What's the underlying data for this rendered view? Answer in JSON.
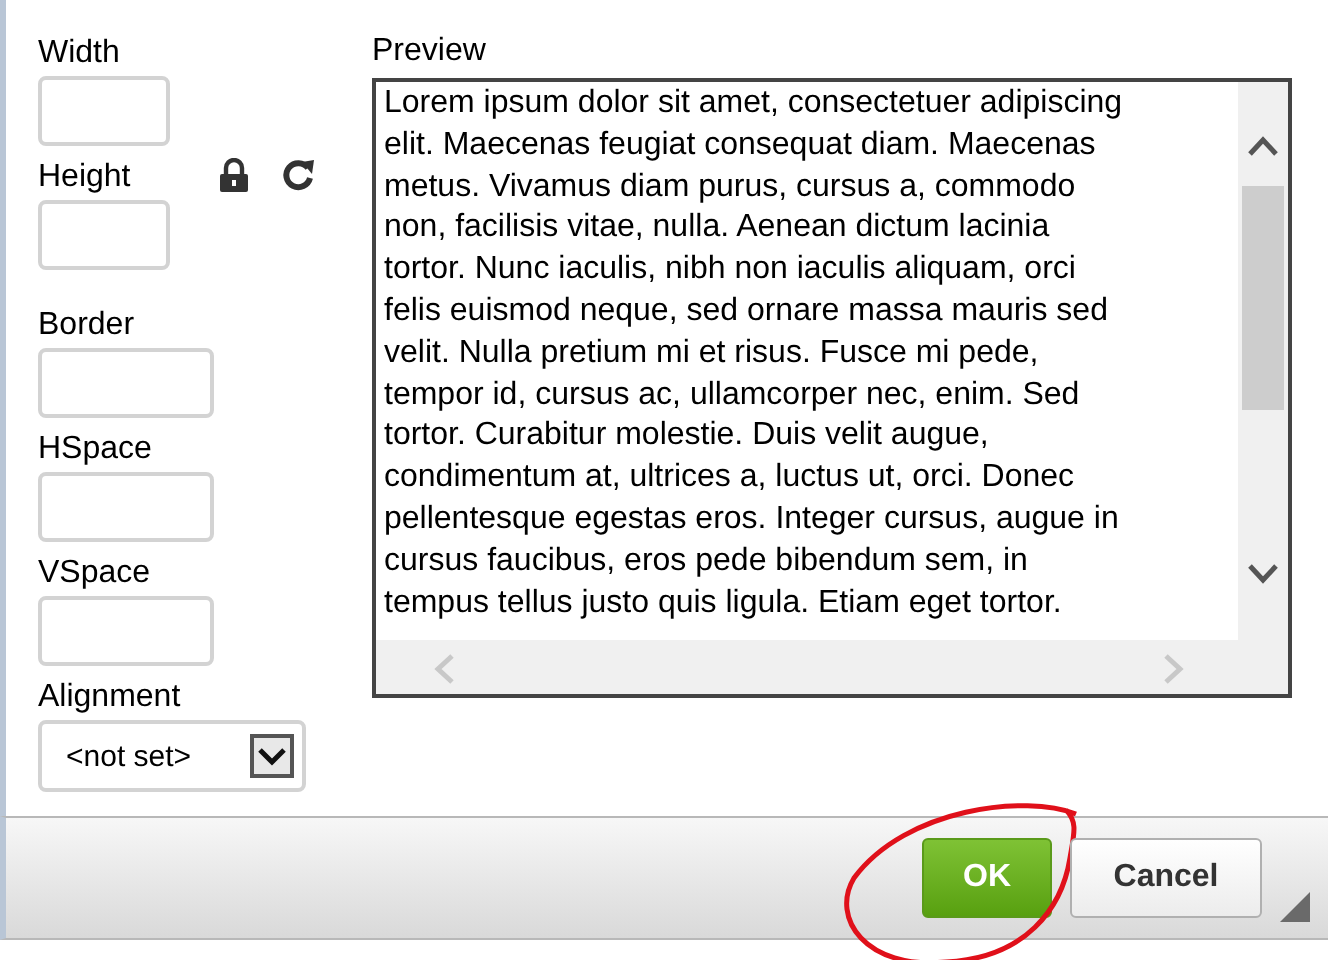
{
  "fields": [
    {
      "label": "Width",
      "kind": "short"
    },
    {
      "label": "Height",
      "kind": "short"
    },
    {
      "label": "Border",
      "kind": "wide"
    },
    {
      "label": "HSpace",
      "kind": "wide"
    },
    {
      "label": "VSpace",
      "kind": "wide"
    }
  ],
  "alignment": {
    "label": "Alignment",
    "value": "<not set>"
  },
  "preview": {
    "label": "Preview",
    "lines": [
      "Lorem ipsum dolor sit amet, consectetuer adipiscing",
      "elit. Maecenas feugiat consequat diam. Maecenas",
      "metus. Vivamus diam purus, cursus a, commodo",
      "non, facilisis vitae, nulla. Aenean dictum lacinia",
      "tortor. Nunc iaculis, nibh non iaculis aliquam, orci",
      "felis euismod neque, sed ornare massa mauris sed",
      "velit. Nulla pretium mi et risus. Fusce mi pede,",
      "tempor id, cursus ac, ullamcorper nec, enim. Sed",
      "tortor. Curabitur molestie. Duis velit augue,",
      "condimentum at, ultrices a, luctus ut, orci. Donec",
      "pellentesque egestas eros. Integer cursus, augue in",
      "cursus faucibus, eros pede bibendum sem, in",
      "tempus tellus justo quis ligula. Etiam eget tortor."
    ]
  },
  "buttons": [
    {
      "label": "OK",
      "kind": "primary",
      "circled": true
    },
    {
      "label": "Cancel",
      "kind": "secondary",
      "circled": false
    }
  ]
}
